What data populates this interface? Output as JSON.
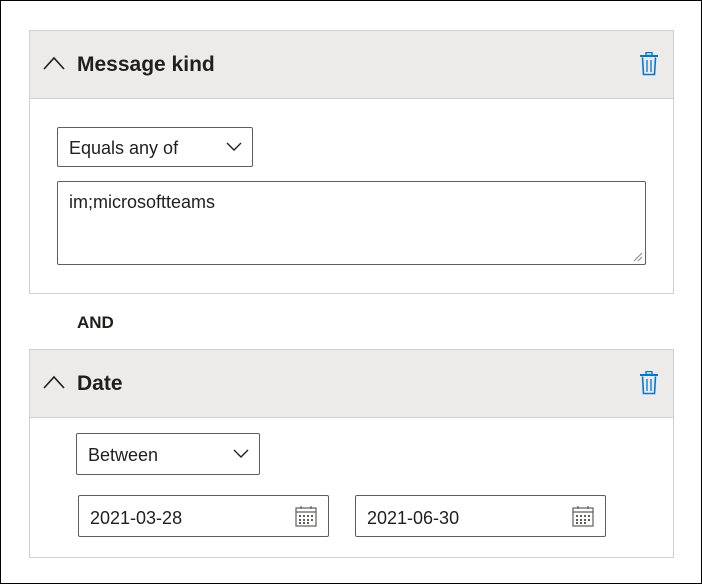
{
  "conditions": [
    {
      "title": "Message kind",
      "operator": "Equals any of",
      "value": "im;microsoftteams"
    },
    {
      "title": "Date",
      "operator": "Between",
      "start_date": "2021-03-28",
      "end_date": "2021-06-30"
    }
  ],
  "connector": "AND",
  "icons": {
    "collapse": "chevron-up-icon",
    "delete": "trash-icon",
    "dropdown": "chevron-down-icon",
    "calendar": "calendar-icon"
  },
  "colors": {
    "accent": "#0078d4",
    "header_bg": "#edebe9",
    "border": "#605e5c"
  }
}
